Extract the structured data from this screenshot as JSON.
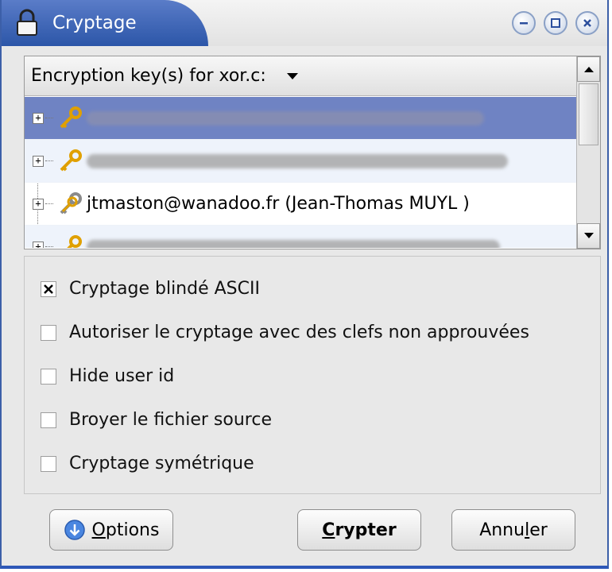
{
  "window": {
    "title": "Cryptage"
  },
  "keylist": {
    "header": "Encryption key(s) for xor.c:",
    "rows": [
      {
        "label": "",
        "redacted": true,
        "state": "selected"
      },
      {
        "label": "",
        "redacted": true,
        "state": "alt"
      },
      {
        "label": "jtmaston@wanadoo.fr (Jean-Thomas MUYL )",
        "redacted": false,
        "state": "normal"
      },
      {
        "label": "",
        "redacted": true,
        "state": "alt"
      }
    ]
  },
  "options": [
    {
      "label": "Cryptage blindé ASCII",
      "checked": true
    },
    {
      "label": "Autoriser le cryptage avec des clefs non approuvées",
      "checked": false
    },
    {
      "label": "Hide user id",
      "checked": false
    },
    {
      "label": "Broyer le fichier source",
      "checked": false
    },
    {
      "label": "Cryptage symétrique",
      "checked": false
    }
  ],
  "buttons": {
    "options_prefix": "",
    "options_mnemonic": "O",
    "options_rest": "ptions",
    "crypter_mnemonic": "C",
    "crypter_rest": "rypter",
    "annuler_prefix": "Annu",
    "annuler_mnemonic": "l",
    "annuler_rest": "er"
  },
  "colors": {
    "titlebar_accent": "#2c56a8",
    "selection": "#6f83c3",
    "key_icon": "#e0a000"
  }
}
